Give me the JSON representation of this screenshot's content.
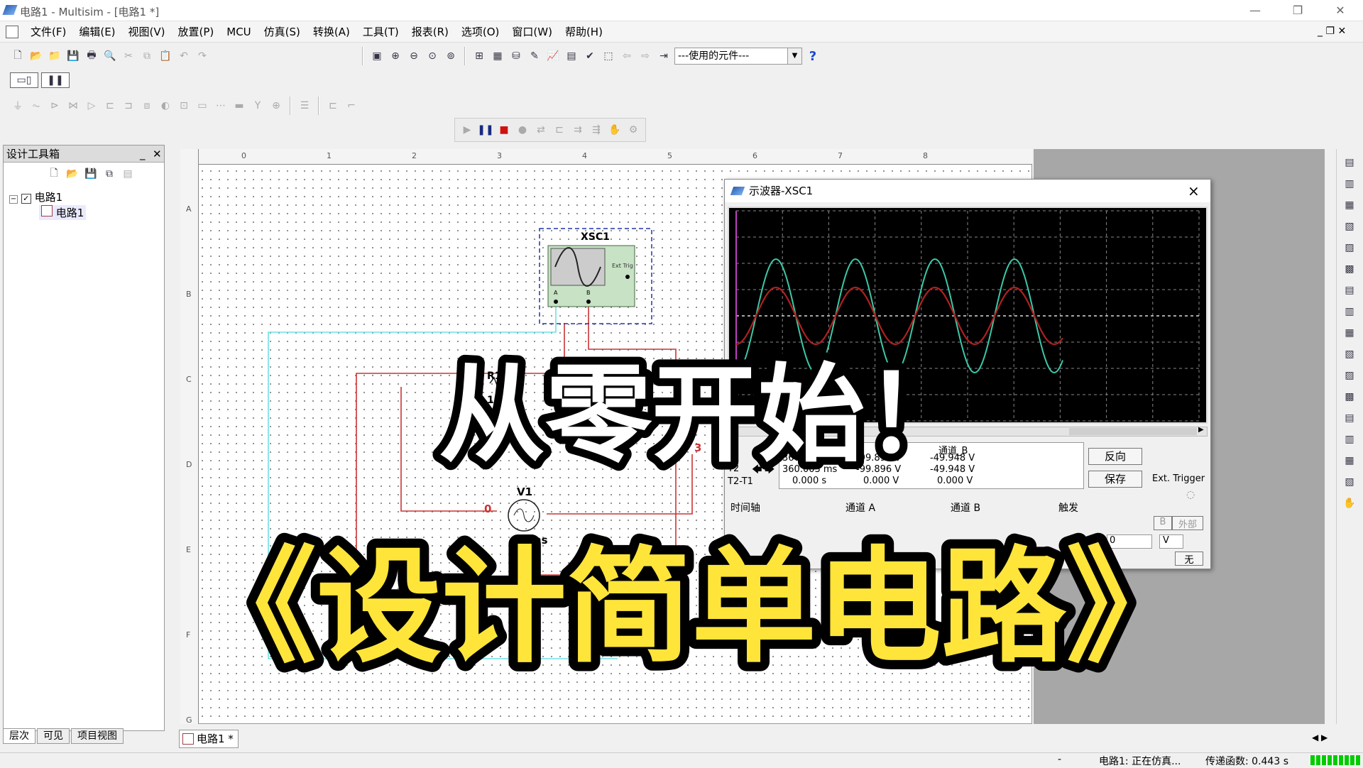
{
  "window": {
    "title": "电路1 - Multisim - [电路1 *]"
  },
  "menu": [
    "文件(F)",
    "编辑(E)",
    "视图(V)",
    "放置(P)",
    "MCU",
    "仿真(S)",
    "转换(A)",
    "工具(T)",
    "报表(R)",
    "选项(O)",
    "窗口(W)",
    "帮助(H)"
  ],
  "toolbar": {
    "component_combo": "---使用的元件---",
    "help_glyph": "?"
  },
  "design_toolbox": {
    "title": "设计工具箱",
    "tree_root": "电路1",
    "tree_child": "电路1",
    "tabs": [
      "层次",
      "可见",
      "项目视图"
    ]
  },
  "schematic": {
    "scope_label": "XSC1",
    "scope_ext": "Ext Trig",
    "scope_pin_a": "A",
    "scope_pin_b": "B",
    "resistor_label": "R1",
    "resistor_value": "100",
    "source_label": "V1",
    "source_units": "Vrms",
    "node_0": "0",
    "node_3": "3",
    "ruler_cols": [
      "0",
      "1",
      "2",
      "3",
      "4",
      "5",
      "6",
      "7",
      "8"
    ],
    "ruler_rows": [
      "A",
      "B",
      "C",
      "D",
      "E",
      "F",
      "G"
    ]
  },
  "oscilloscope": {
    "title": "示波器-XSC1",
    "close": "×",
    "col_b": "通道_B",
    "col_a": "A",
    "t1_label": "1",
    "t2_label": "T2",
    "t2t1_label": "T2-T1",
    "t1_time": "360.003 ms",
    "t1_a": "-99.896 V",
    "t1_b": "-49.948 V",
    "t2_time": "360.003 ms",
    "t2_a": "-99.896 V",
    "t2_b": "-49.948 V",
    "d_time": "0.000 s",
    "d_a": "0.000 V",
    "d_b": "0.000 V",
    "reverse_btn": "反向",
    "save_btn": "保存",
    "ext_trigger": "Ext. Trigger",
    "sec_timebase": "时间轴",
    "sec_cha": "通道 A",
    "sec_chb": "通道 B",
    "sec_trigger": "触发",
    "trig_b": "B",
    "trig_ext": "外部",
    "trig_level": "0",
    "trig_unit": "V",
    "trig_none": "无",
    "ch_a_color": "#b02020",
    "ch_b_color": "#3cc8a8"
  },
  "document_tab": "电路1 *",
  "status": {
    "left": "-",
    "sim": "电路1: 正在仿真...",
    "transfer": "传递函数: 0.443 s"
  },
  "overlay": {
    "line1": "从零开始！",
    "line2": "《设计简单电路》",
    "line2_color": "#ffe53a"
  }
}
